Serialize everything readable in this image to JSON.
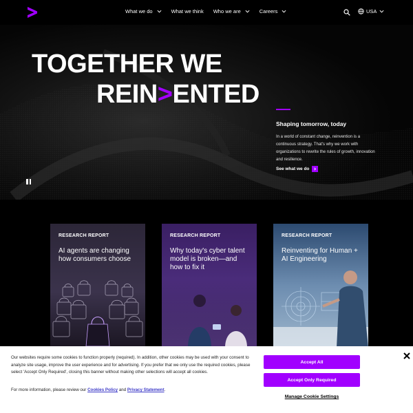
{
  "header": {
    "nav": [
      {
        "label": "What we do",
        "has_menu": true
      },
      {
        "label": "What we think",
        "has_menu": false
      },
      {
        "label": "Who we are",
        "has_menu": true
      },
      {
        "label": "Careers",
        "has_menu": true
      }
    ],
    "locale": "USA"
  },
  "hero": {
    "title_line1": "TOGETHER WE",
    "title_line2_a": "REIN",
    "title_line2_b": ">",
    "title_line2_c": "ENTED",
    "subtitle": "Shaping tomorrow, today",
    "body": "In a world of constant change, reinvention is a continuous strategy. That's why we work with organizations to rewrite the rules of growth, innovation and resilience.",
    "cta": "See what we do"
  },
  "cards": [
    {
      "tag": "RESEARCH REPORT",
      "title": "AI agents are changing how consumers choose"
    },
    {
      "tag": "RESEARCH REPORT",
      "title": "Why today's cyber talent model is broken—and how to fix it"
    },
    {
      "tag": "RESEARCH REPORT",
      "title": "Reinventing for Human + AI Engineering"
    }
  ],
  "cookie": {
    "text": "Our websites require some cookies to function properly (required). In addition, other cookies may be used with your consent to analyze site usage, improve the user experience and for advertising. If you prefer that we only use the required cookies, please select 'Accept Only Required', closing this banner without making other selections will accept all cookies.",
    "more_prefix": "For more information, please review our ",
    "policy_link": "Cookies Policy",
    "and": " and ",
    "privacy_link": "Privacy Statement",
    "period": ".",
    "accept_all": "Accept All",
    "accept_required": "Accept Only Required",
    "manage": "Manage Cookie Settings"
  },
  "colors": {
    "accent": "#a100ff",
    "background": "#000000",
    "link": "#3a37c7"
  },
  "icons": [
    "accenture-logo-icon",
    "chevron-down-icon",
    "search-icon",
    "globe-icon",
    "arrow-right-icon",
    "pause-icon",
    "close-icon"
  ]
}
